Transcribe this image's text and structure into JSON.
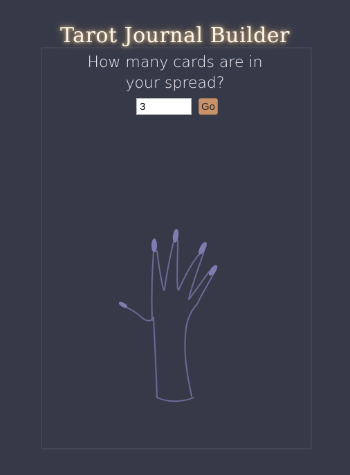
{
  "app": {
    "title": "Tarot Journal Builder"
  },
  "prompt": {
    "question": "How many cards are in your spread?"
  },
  "form": {
    "card_count_value": "3",
    "go_label": "Go"
  },
  "illustration": {
    "icon": "hand-illustration-icon",
    "stroke_color": "#6b6a95",
    "nail_color": "#7f7cb0"
  },
  "colors": {
    "background": "#363a48",
    "frame_border": "#404455",
    "title_glow": "#ffd696",
    "button": "#c8926a"
  }
}
